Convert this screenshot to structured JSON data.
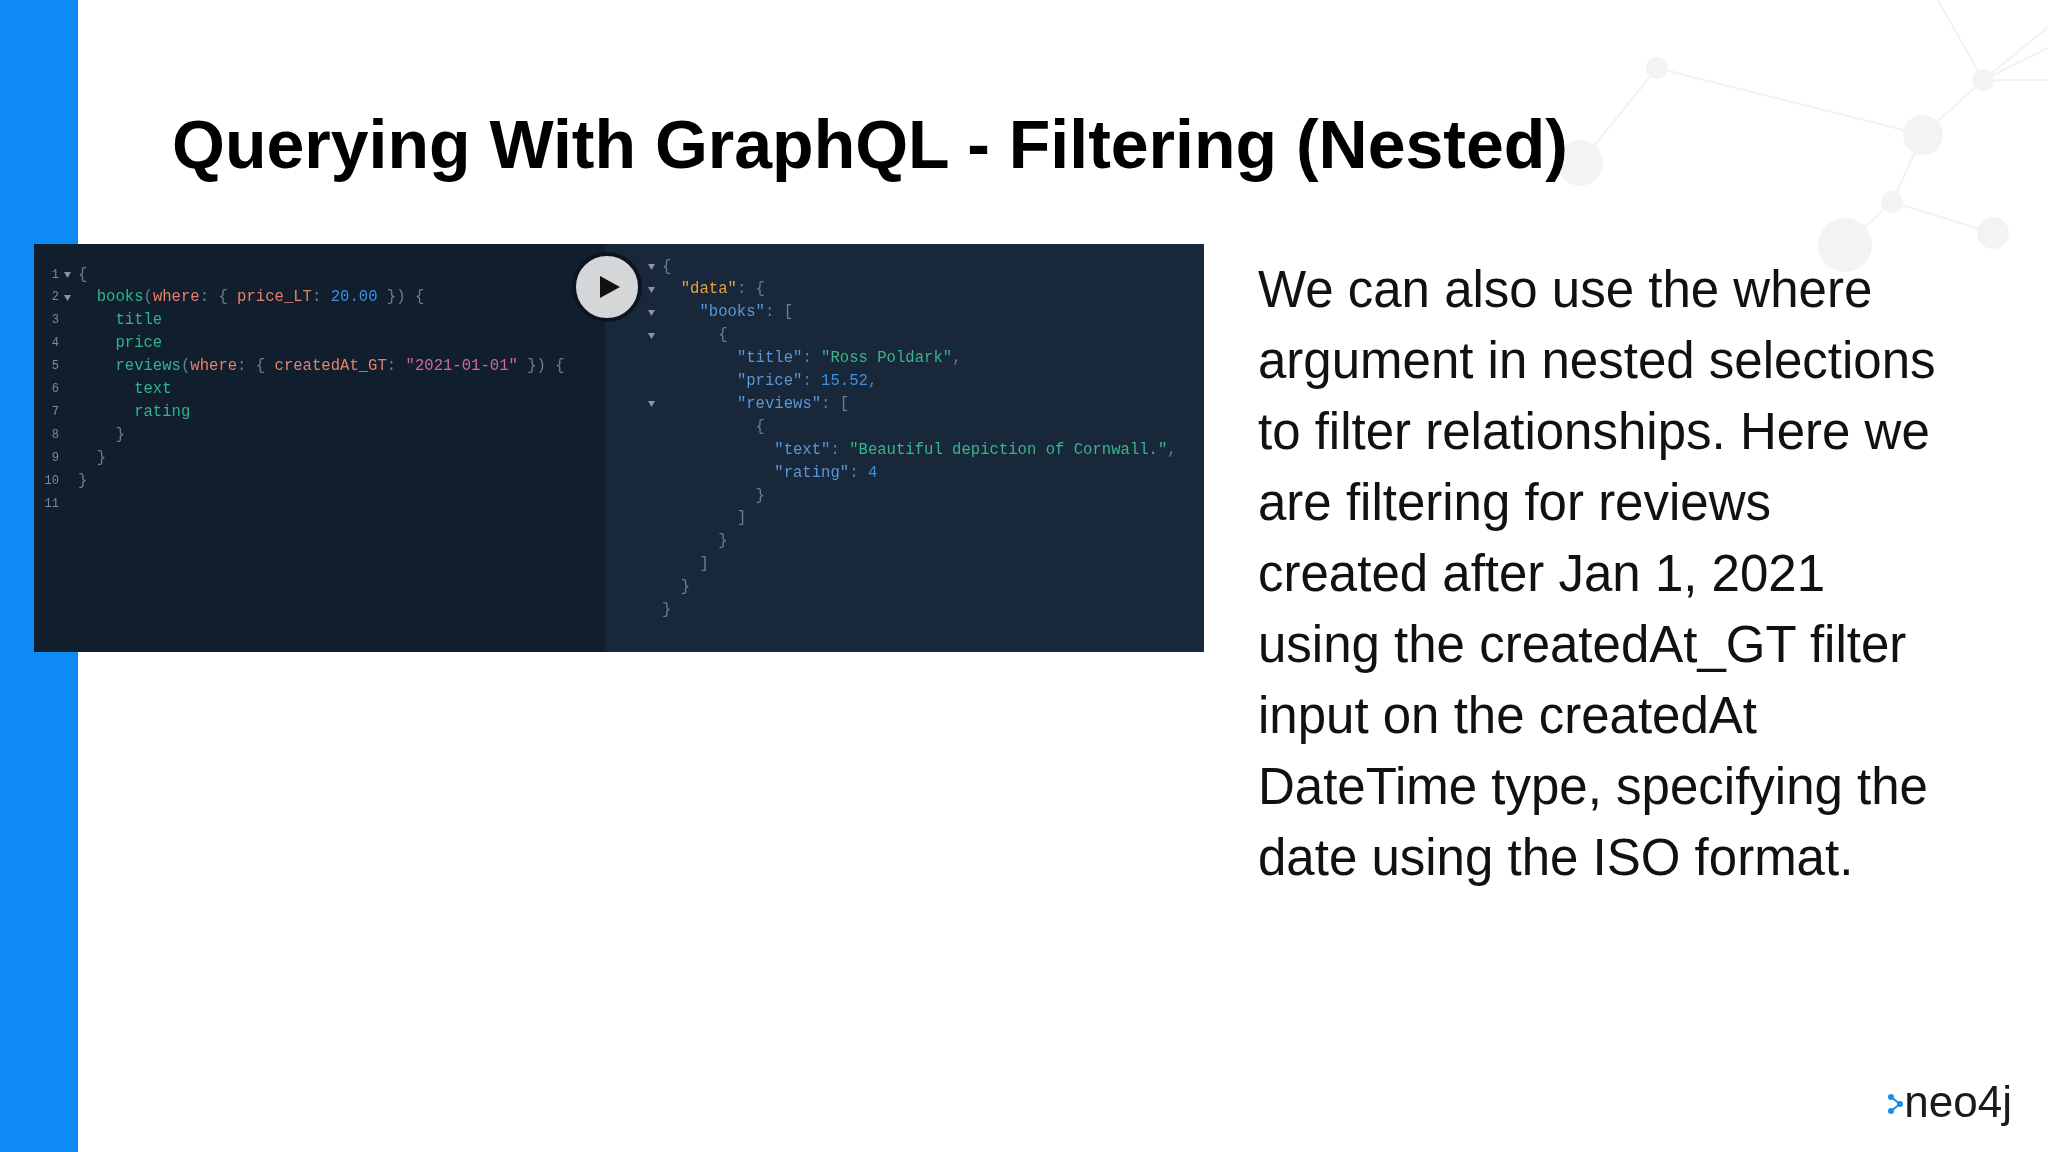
{
  "slide": {
    "title": "Querying With GraphQL - Filtering (Nested)"
  },
  "query_editor": {
    "lines": [
      {
        "number": "1",
        "fold": true,
        "tokens": [
          {
            "kind": "punctuation",
            "text": "{"
          }
        ]
      },
      {
        "number": "2",
        "fold": true,
        "tokens": [
          {
            "kind": "field",
            "text": "  books"
          },
          {
            "kind": "punctuation",
            "text": "("
          },
          {
            "kind": "argument",
            "text": "where"
          },
          {
            "kind": "punctuation",
            "text": ": { "
          },
          {
            "kind": "argument",
            "text": "price_LT"
          },
          {
            "kind": "punctuation",
            "text": ": "
          },
          {
            "kind": "number",
            "text": "20.00"
          },
          {
            "kind": "punctuation",
            "text": " }) {"
          }
        ]
      },
      {
        "number": "3",
        "fold": false,
        "tokens": [
          {
            "kind": "field",
            "text": "    title"
          }
        ]
      },
      {
        "number": "4",
        "fold": false,
        "tokens": [
          {
            "kind": "field",
            "text": "    price"
          }
        ]
      },
      {
        "number": "5",
        "fold": false,
        "tokens": [
          {
            "kind": "field",
            "text": "    reviews"
          },
          {
            "kind": "punctuation",
            "text": "("
          },
          {
            "kind": "argument",
            "text": "where"
          },
          {
            "kind": "punctuation",
            "text": ": { "
          },
          {
            "kind": "argument",
            "text": "createdAt_GT"
          },
          {
            "kind": "punctuation",
            "text": ": "
          },
          {
            "kind": "string",
            "text": "\"2021-01-01\""
          },
          {
            "kind": "punctuation",
            "text": " }) {"
          }
        ]
      },
      {
        "number": "6",
        "fold": false,
        "tokens": [
          {
            "kind": "field",
            "text": "      text"
          }
        ]
      },
      {
        "number": "7",
        "fold": false,
        "tokens": [
          {
            "kind": "field",
            "text": "      rating"
          }
        ]
      },
      {
        "number": "8",
        "fold": false,
        "tokens": [
          {
            "kind": "punctuation",
            "text": "    }"
          }
        ]
      },
      {
        "number": "9",
        "fold": false,
        "tokens": [
          {
            "kind": "punctuation",
            "text": "  }"
          }
        ]
      },
      {
        "number": "10",
        "fold": false,
        "tokens": [
          {
            "kind": "punctuation",
            "text": "}"
          }
        ]
      },
      {
        "number": "11",
        "fold": false
      }
    ]
  },
  "result_viewer": {
    "lines": [
      {
        "fold": true,
        "tokens": [
          {
            "kind": "punctuation",
            "text": "{"
          }
        ]
      },
      {
        "fold": true,
        "tokens": [
          {
            "kind": "root_key",
            "text": "  \"data\""
          },
          {
            "kind": "punctuation",
            "text": ": {"
          }
        ]
      },
      {
        "fold": true,
        "tokens": [
          {
            "kind": "key",
            "text": "    \"books\""
          },
          {
            "kind": "punctuation",
            "text": ": ["
          }
        ]
      },
      {
        "fold": true,
        "tokens": [
          {
            "kind": "punctuation",
            "text": "      {"
          }
        ]
      },
      {
        "fold": false,
        "tokens": [
          {
            "kind": "key",
            "text": "        \"title\""
          },
          {
            "kind": "punctuation",
            "text": ": "
          },
          {
            "kind": "string",
            "text": "\"Ross Poldark\""
          },
          {
            "kind": "punctuation",
            "text": ","
          }
        ]
      },
      {
        "fold": false,
        "tokens": [
          {
            "kind": "key",
            "text": "        \"price\""
          },
          {
            "kind": "punctuation",
            "text": ": "
          },
          {
            "kind": "number",
            "text": "15.52"
          },
          {
            "kind": "punctuation",
            "text": ","
          }
        ]
      },
      {
        "fold": true,
        "tokens": [
          {
            "kind": "key",
            "text": "        \"reviews\""
          },
          {
            "kind": "punctuation",
            "text": ": ["
          }
        ]
      },
      {
        "fold": false,
        "tokens": [
          {
            "kind": "punctuation",
            "text": "          {"
          }
        ]
      },
      {
        "fold": false,
        "tokens": [
          {
            "kind": "key",
            "text": "            \"text\""
          },
          {
            "kind": "punctuation",
            "text": ": "
          },
          {
            "kind": "string",
            "text": "\"Beautiful depiction of Cornwall.\""
          },
          {
            "kind": "punctuation",
            "text": ","
          }
        ]
      },
      {
        "fold": false,
        "tokens": [
          {
            "kind": "key",
            "text": "            \"rating\""
          },
          {
            "kind": "punctuation",
            "text": ": "
          },
          {
            "kind": "number",
            "text": "4"
          }
        ]
      },
      {
        "fold": false,
        "tokens": [
          {
            "kind": "punctuation",
            "text": "          }"
          }
        ]
      },
      {
        "fold": false,
        "tokens": [
          {
            "kind": "punctuation",
            "text": "        ]"
          }
        ]
      },
      {
        "fold": false,
        "tokens": [
          {
            "kind": "punctuation",
            "text": "      }"
          }
        ]
      },
      {
        "fold": false,
        "tokens": [
          {
            "kind": "punctuation",
            "text": "    ]"
          }
        ]
      },
      {
        "fold": false,
        "tokens": [
          {
            "kind": "punctuation",
            "text": "  }"
          }
        ]
      },
      {
        "fold": false,
        "tokens": [
          {
            "kind": "punctuation",
            "text": "}"
          }
        ]
      }
    ]
  },
  "description": "We can also use the where argument in nested selections to filter relationships. Here we are filtering for reviews created after Jan 1, 2021 using the createdAt_GT filter input on the createdAt DateTime type, specifying the date using the ISO format.",
  "logo": {
    "text": "neo4j"
  }
}
